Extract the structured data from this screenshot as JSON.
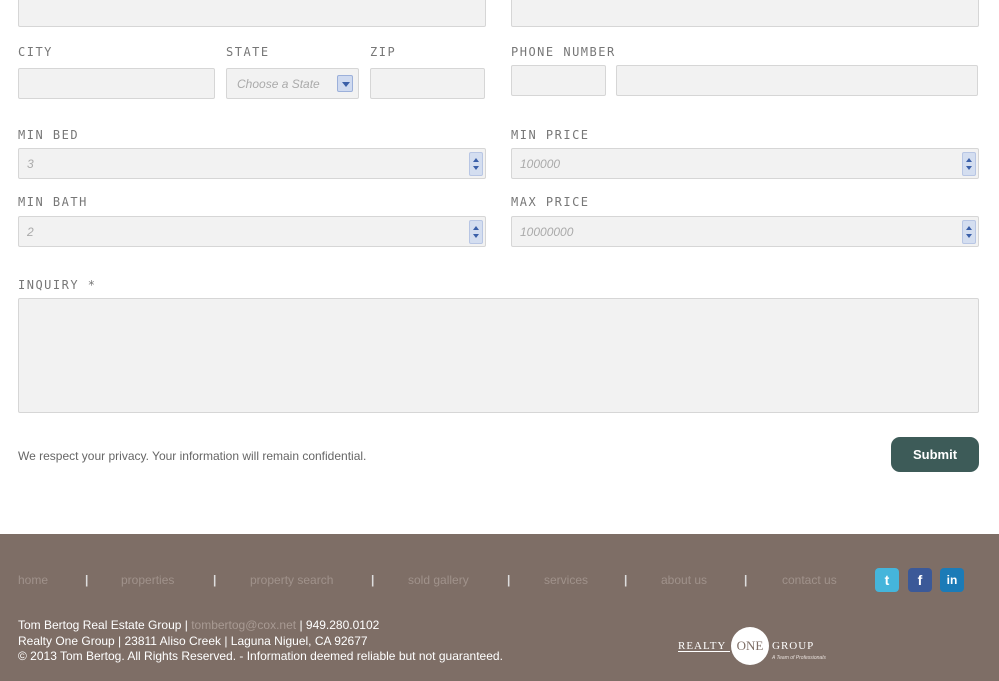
{
  "form": {
    "city_label": "CITY",
    "state_label": "STATE",
    "state_selected": "Choose a State",
    "zip_label": "ZIP",
    "phone_label": "PHONE NUMBER",
    "min_bed_label": "MIN BED",
    "min_bed_value": "3",
    "min_price_label": "MIN PRICE",
    "min_price_value": "100000",
    "min_bath_label": "MIN BATH",
    "min_bath_value": "2",
    "max_price_label": "MAX PRICE",
    "max_price_value": "10000000",
    "inquiry_label": "INQUIRY *",
    "privacy_text": "We respect your privacy. Your information will remain confidential.",
    "submit_label": "Submit"
  },
  "footer": {
    "nav": [
      "home",
      "properties",
      "property search",
      "sold gallery",
      "services",
      "about us",
      "contact us"
    ],
    "separator": "|",
    "social": [
      "twitter-icon",
      "facebook-icon",
      "linkedin-icon"
    ],
    "info_line1_prefix": "Tom Bertog Real Estate Group | ",
    "info_email": "tombertog@cox.net",
    "info_line1_suffix": " | 949.280.0102",
    "info_line2": "Realty One Group | 23811 Aliso Creek | Laguna Niguel, CA 92677",
    "info_line3": "© 2013 Tom Bertog. All Rights Reserved. - Information deemed reliable but not guaranteed.",
    "logo_left": "REALTY",
    "logo_circle": "ONE",
    "logo_right": "GROUP",
    "logo_tagline": "A Team of Professionals"
  },
  "colors": {
    "footer_bg": "#7e6e66",
    "submit_bg": "#3d5b58",
    "field_bg": "#f2f2f2"
  }
}
